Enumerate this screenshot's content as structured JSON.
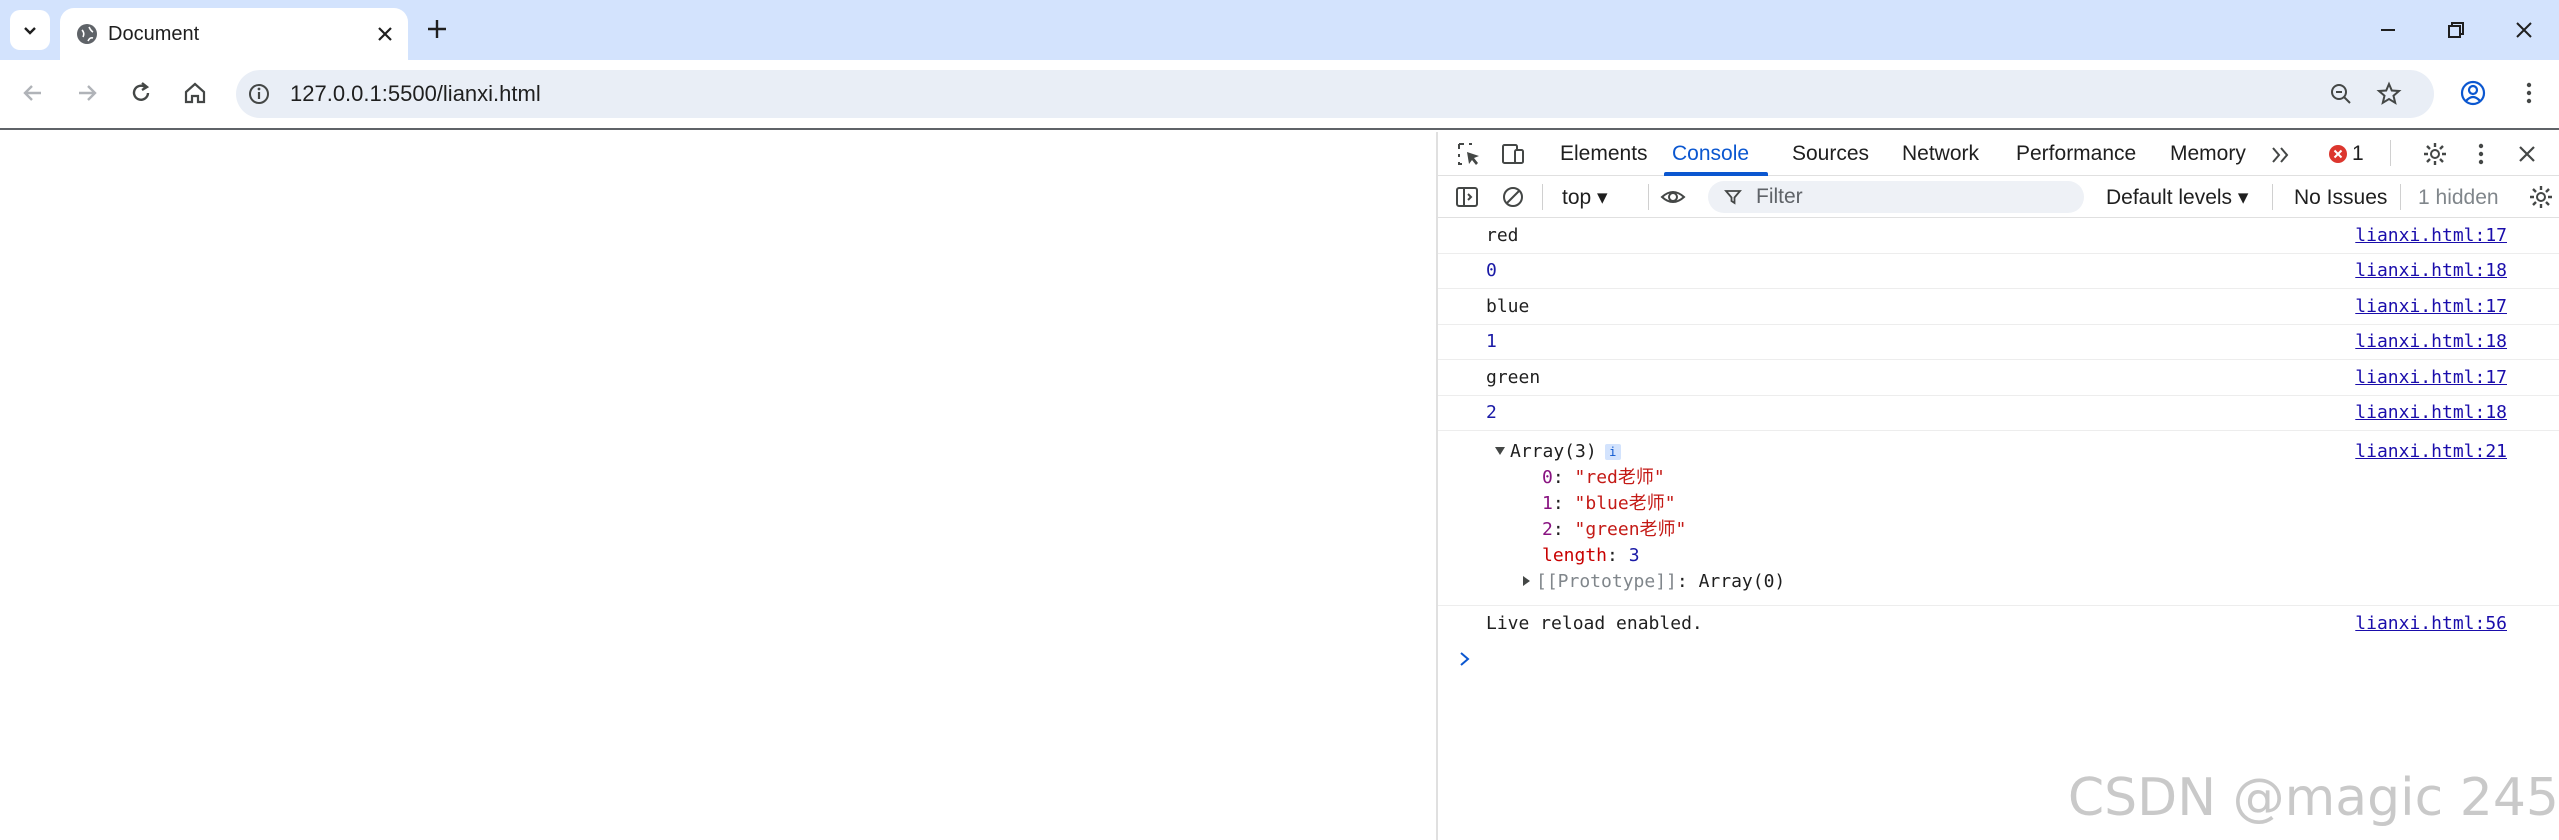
{
  "browser": {
    "tab": {
      "title": "Document"
    },
    "address_bar": {
      "url": "127.0.0.1:5500/lianxi.html"
    }
  },
  "devtools": {
    "tabs": [
      "Elements",
      "Console",
      "Sources",
      "Network",
      "Performance",
      "Memory"
    ],
    "active_tab": "Console",
    "error_count": "1",
    "toolbar": {
      "context": "top",
      "filter_placeholder": "Filter",
      "levels": "Default levels",
      "issues": "No Issues",
      "hidden": "1 hidden"
    }
  },
  "console": {
    "messages": [
      {
        "text": "red",
        "source": "lianxi.html:17",
        "kind": "string"
      },
      {
        "text": "0",
        "source": "lianxi.html:18",
        "kind": "number"
      },
      {
        "text": "blue",
        "source": "lianxi.html:17",
        "kind": "string"
      },
      {
        "text": "1",
        "source": "lianxi.html:18",
        "kind": "number"
      },
      {
        "text": "green",
        "source": "lianxi.html:17",
        "kind": "string"
      },
      {
        "text": "2",
        "source": "lianxi.html:18",
        "kind": "number"
      }
    ],
    "array_entry": {
      "summary": "Array(3)",
      "source": "lianxi.html:21",
      "items": [
        {
          "key": "0",
          "value": "\"red老师\""
        },
        {
          "key": "1",
          "value": "\"blue老师\""
        },
        {
          "key": "2",
          "value": "\"green老师\""
        }
      ],
      "length_key": "length",
      "length_value": "3",
      "prototype_key": "[[Prototype]]",
      "prototype_value": "Array(0)"
    },
    "final_message": {
      "text": "Live reload enabled.",
      "source": "lianxi.html:56"
    }
  },
  "watermark": "CSDN @magic 245"
}
